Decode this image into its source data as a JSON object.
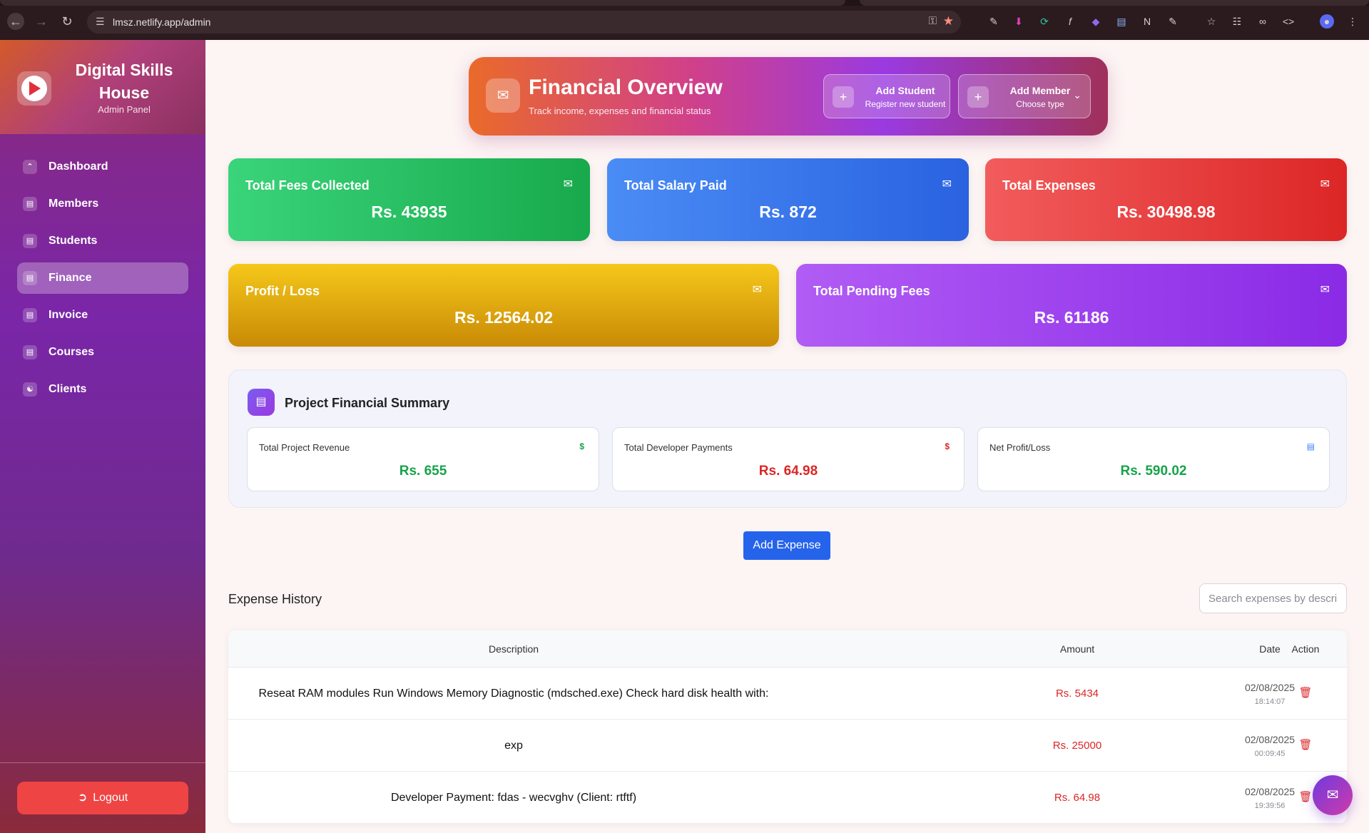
{
  "browser": {
    "url": "lmsz.netlify.app/admin"
  },
  "sidebar": {
    "brand": "Digital Skills House",
    "subtitle": "Admin Panel",
    "items": [
      {
        "label": "Dashboard",
        "icon": "dashboard-icon"
      },
      {
        "label": "Members",
        "icon": "book-icon"
      },
      {
        "label": "Students",
        "icon": "book-icon"
      },
      {
        "label": "Finance",
        "icon": "book-icon",
        "active": true
      },
      {
        "label": "Invoice",
        "icon": "document-icon"
      },
      {
        "label": "Courses",
        "icon": "book-icon"
      },
      {
        "label": "Clients",
        "icon": "people-icon"
      }
    ],
    "logout": "Logout"
  },
  "hero": {
    "title": "Financial Overview",
    "subtitle": "Track income, expenses and financial status",
    "add_student": {
      "title": "Add Student",
      "sub": "Register new student"
    },
    "add_member": {
      "title": "Add Member",
      "sub": "Choose type"
    }
  },
  "stats": [
    {
      "title": "Total Fees Collected",
      "value": "Rs. 43935",
      "color": "#22c55e"
    },
    {
      "title": "Total Salary Paid",
      "value": "Rs. 872",
      "color": "#3b82f6"
    },
    {
      "title": "Total Expenses",
      "value": "Rs. 30498.98",
      "color": "#ef4444"
    },
    {
      "title": "Profit / Loss",
      "value": "Rs. 12564.02",
      "color": "#eab308"
    },
    {
      "title": "Total Pending Fees",
      "value": "Rs. 61186",
      "color": "#a855f7"
    }
  ],
  "summary": {
    "title": "Project Financial Summary",
    "cards": [
      {
        "label": "Total Project Revenue",
        "value": "Rs. 655",
        "icon": "$",
        "color": "#16a34a"
      },
      {
        "label": "Total Developer Payments",
        "value": "Rs. 64.98",
        "icon": "$",
        "color": "#dc2626"
      },
      {
        "label": "Net Profit/Loss",
        "value": "Rs. 590.02",
        "icon": "clipboard-icon",
        "color": "#16a34a"
      }
    ]
  },
  "add_expense": "Add Expense",
  "expense_history": {
    "title": "Expense History",
    "search_placeholder": "Search expenses by description",
    "columns": [
      "Description",
      "Amount",
      "Date",
      "Action"
    ],
    "rows": [
      {
        "description": "Reseat RAM modules Run Windows Memory Diagnostic (mdsched.exe) Check hard disk health with:",
        "amount": "Rs. 5434",
        "date": "02/08/2025",
        "time": "18:14:07"
      },
      {
        "description": "exp",
        "amount": "Rs. 25000",
        "date": "02/08/2025",
        "time": "00:09:45"
      },
      {
        "description": "Developer Payment: fdas - wecvghv (Client: rtftf)",
        "amount": "Rs. 64.98",
        "date": "02/08/2025",
        "time": "19:39:56"
      }
    ]
  }
}
